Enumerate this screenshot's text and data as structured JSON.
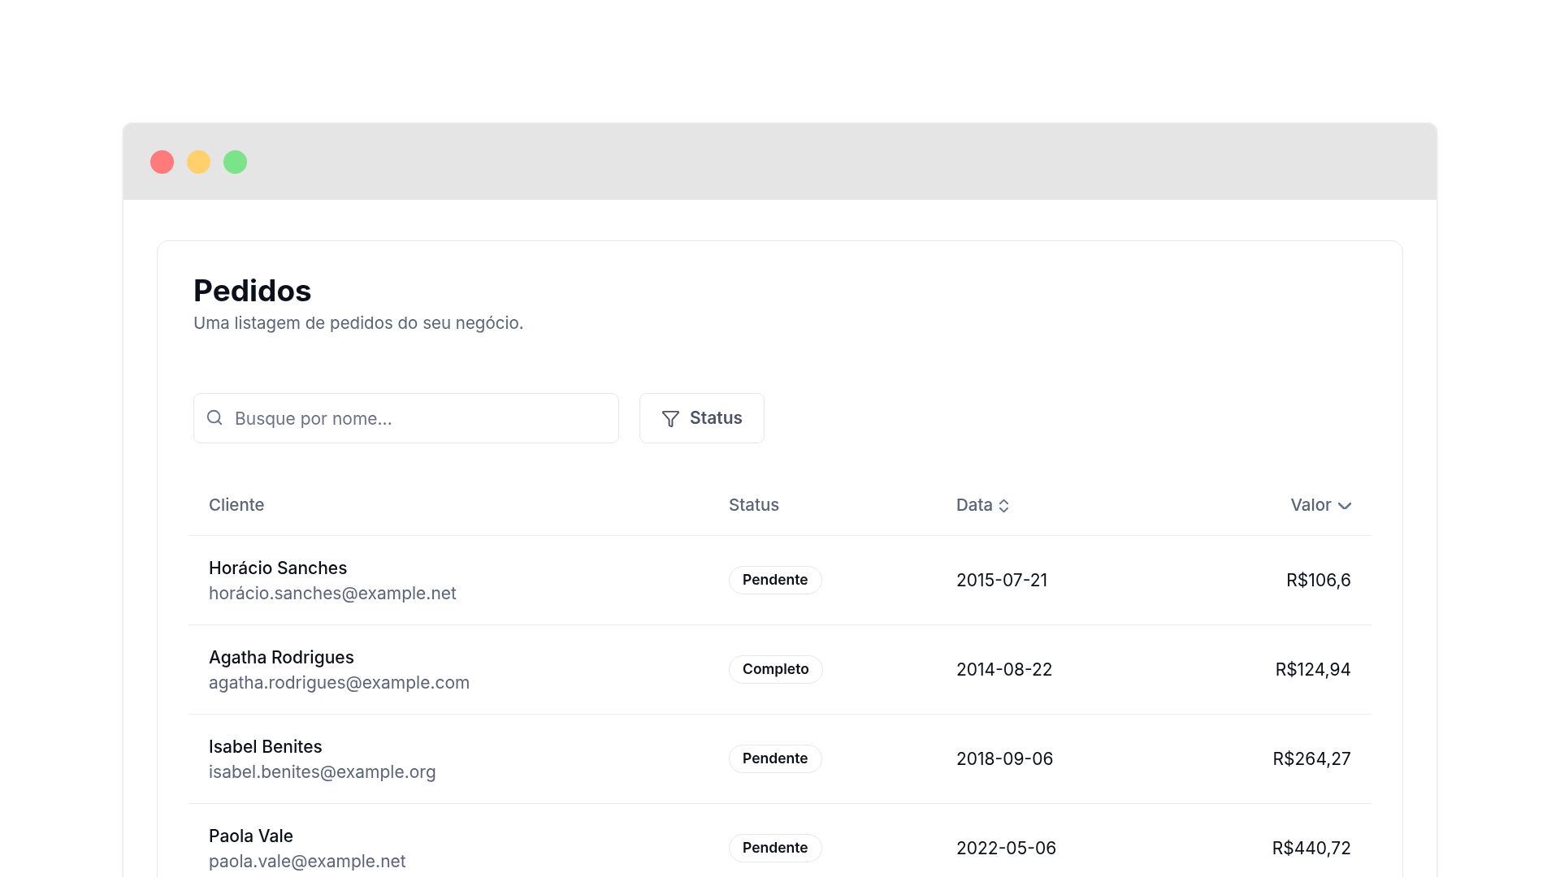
{
  "page": {
    "title": "Pedidos",
    "subtitle": "Uma listagem de pedidos do seu negócio."
  },
  "search": {
    "placeholder": "Busque por nome..."
  },
  "filter_button": {
    "label": "Status"
  },
  "table": {
    "columns": [
      {
        "label": "Cliente"
      },
      {
        "label": "Status"
      },
      {
        "label": "Data",
        "sorted": false
      },
      {
        "label": "Valor",
        "sorted": true
      }
    ],
    "rows": [
      {
        "name": "Horácio Sanches",
        "email": "horácio.sanches@example.net",
        "status": "Pendente",
        "date": "2015-07-21",
        "value": "R$106,6"
      },
      {
        "name": "Agatha Rodrigues",
        "email": "agatha.rodrigues@example.com",
        "status": "Completo",
        "date": "2014-08-22",
        "value": "R$124,94"
      },
      {
        "name": "Isabel Benites",
        "email": "isabel.benites@example.org",
        "status": "Pendente",
        "date": "2018-09-06",
        "value": "R$264,27"
      },
      {
        "name": "Paola Vale",
        "email": "paola.vale@example.net",
        "status": "Pendente",
        "date": "2022-05-06",
        "value": "R$440,72"
      }
    ]
  }
}
